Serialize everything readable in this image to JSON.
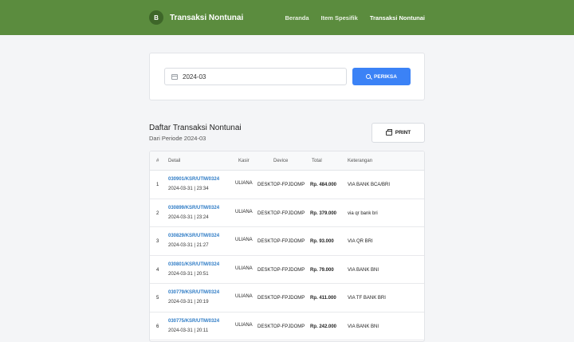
{
  "nav": {
    "brand_initial": "B",
    "brand_title": "Transaksi Nontunai",
    "links": [
      "Beranda",
      "Item Spesifik",
      "Transaksi Nontunai"
    ]
  },
  "search": {
    "month_value": "2024-03",
    "button_label": "PERIKSA"
  },
  "list": {
    "title": "Daftar Transaksi Nontunai",
    "subtitle": "Dari Periode 2024-03",
    "print_label": "PRINT"
  },
  "table": {
    "headers": [
      "#",
      "Detail",
      "Kasir",
      "Device",
      "Total",
      "Keterangan"
    ],
    "rows": [
      {
        "no": "1",
        "code": "030901/KSR/UTM/0324",
        "date": "2024-03-31 | 23:34",
        "kasir": "ULIANA",
        "device": "DESKTOP-FPJDOMP",
        "total": "Rp. 484.000",
        "ket": "VIA BANK BCA/BRI"
      },
      {
        "no": "2",
        "code": "030899/KSR/UTM/0324",
        "date": "2024-03-31 | 23:24",
        "kasir": "ULIANA",
        "device": "DESKTOP-FPJDOMP",
        "total": "Rp. 379.000",
        "ket": "via qr bank bri"
      },
      {
        "no": "3",
        "code": "030829/KSR/UTM/0324",
        "date": "2024-03-31 | 21:27",
        "kasir": "ULIANA",
        "device": "DESKTOP-FPJDOMP",
        "total": "Rp. 93.000",
        "ket": "VIA QR BRI"
      },
      {
        "no": "4",
        "code": "030801/KSR/UTM/0324",
        "date": "2024-03-31 | 20:51",
        "kasir": "ULIANA",
        "device": "DESKTOP-FPJDOMP",
        "total": "Rp. 79.000",
        "ket": "VIA BANK BNI"
      },
      {
        "no": "5",
        "code": "030779/KSR/UTM/0324",
        "date": "2024-03-31 | 20:19",
        "kasir": "ULIANA",
        "device": "DESKTOP-FPJDOMP",
        "total": "Rp. 411.000",
        "ket": "VIA TF BANK BRI"
      },
      {
        "no": "6",
        "code": "030775/KSR/UTM/0324",
        "date": "2024-03-31 | 20:11",
        "kasir": "ULIANA",
        "device": "DESKTOP-FPJDOMP",
        "total": "Rp. 242.000",
        "ket": "VIA BANK BNI"
      }
    ]
  }
}
